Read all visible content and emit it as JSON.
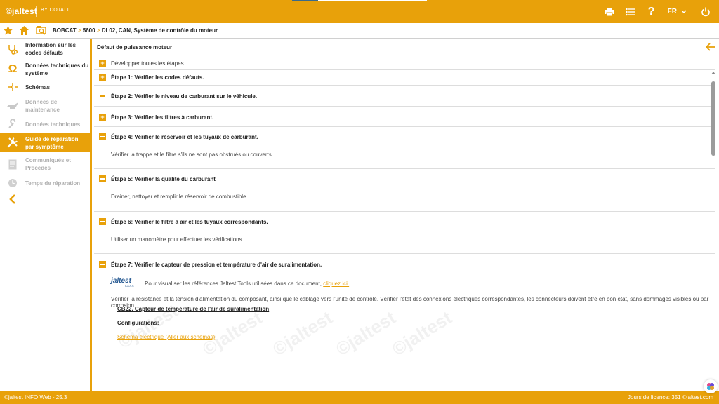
{
  "header": {
    "brand": "©jaltest",
    "by": "BY COJALI",
    "language": "FR",
    "colors": {
      "accent": "#e8a10a",
      "white": "#ffffff"
    },
    "icons": [
      "printer-icon",
      "list-icon",
      "help-icon",
      "chevron-down-icon",
      "power-icon"
    ]
  },
  "breadcrumb": {
    "part1": "BOBCAT",
    "part2": "5600",
    "part3": "DL02, CAN, Système de contrôle du moteur",
    "sep": ">"
  },
  "sidebar": {
    "items": [
      {
        "label1": "Information sur les",
        "label2": "codes défauts",
        "state": "normal",
        "icon": "stethoscope-icon"
      },
      {
        "label1": "Données techniques du",
        "label2": "système",
        "state": "normal",
        "icon": "omega-icon"
      },
      {
        "label1": "Schémas",
        "label2": "",
        "state": "normal",
        "icon": "schematic-icon"
      },
      {
        "label1": "Données de",
        "label2": "maintenance",
        "state": "disabled",
        "icon": "oil-can-icon"
      },
      {
        "label1": "Données techniques",
        "label2": "",
        "state": "disabled",
        "icon": "wrench-icon"
      },
      {
        "label1": "Guide de réparation",
        "label2": "par symptôme",
        "state": "active",
        "icon": "tools-icon"
      },
      {
        "label1": "Communiqués et",
        "label2": "Procédés",
        "state": "disabled",
        "icon": "document-icon"
      },
      {
        "label1": "Temps de réparation",
        "label2": "",
        "state": "disabled",
        "icon": "clock-icon"
      }
    ]
  },
  "main": {
    "title": "Défaut de puissance moteur",
    "expand_all": "Développer toutes les étapes",
    "steps": [
      {
        "title": "Étape 1: Vérifier les codes défauts.",
        "body": ""
      },
      {
        "title": "Étape 2: Vérifier le niveau de carburant sur le véhicule.",
        "body": ""
      },
      {
        "title": "Étape 3: Vérifier les filtres à carburant.",
        "body": ""
      },
      {
        "title": "Étape 4: Vérifier le réservoir et les tuyaux de carburant.",
        "body": "Vérifier la trappe et le filtre s'ils ne sont pas obstrués ou couverts."
      },
      {
        "title": "Étape 5: Vérifier la qualité du carburant",
        "body": "Drainer, nettoyer et remplir le réservoir de combustible"
      },
      {
        "title": "Étape 6: Vérifier le filtre à air et les tuyaux correspondants.",
        "body": "Utiliser un manomètre pour effectuer les vérifications."
      },
      {
        "title": "Étape 7: Vérifier le capteur de pression et température d'air de suralimentation.",
        "body": ""
      }
    ],
    "step7": {
      "logo_text": "jaltest",
      "logo_sub": "TOOLS",
      "tools_text": "Pour visualiser les références Jaltest Tools utilisées dans ce document,",
      "tools_link": "cliquez ici.",
      "description": "Vérifier la résistance et la tension d'alimentation du composant, ainsi que le câblage vers l'unité de contrôle. Vérifier l'état des connexions électriques correspondantes, les connecteurs doivent être en bon état, sans dommages visibles ou par corrosion.",
      "component": "CB22. Capteur de température de l'air de suralimentation",
      "config_label": "Configurations:",
      "schema_link": "Schéma électrique (Aller aux schémas)"
    },
    "watermark": "©jaltest"
  },
  "footer": {
    "version": "©jaltest INFO Web - 25.3",
    "license_label": "Jours de licence:",
    "license_days": "351",
    "site": "©jaltest.com"
  }
}
